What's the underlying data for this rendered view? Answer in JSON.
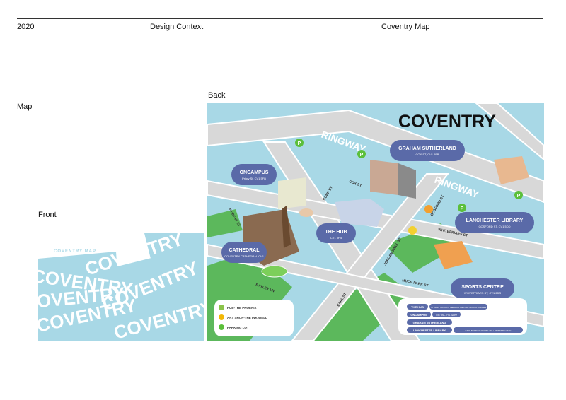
{
  "header": {
    "year": "2020",
    "section": "Design Context",
    "project": "Coventry Map"
  },
  "labels": {
    "map": "Map",
    "front": "Front",
    "back": "Back"
  },
  "front": {
    "small_title": "COVENTRY MAP",
    "word": "COVENTRY"
  },
  "back_map": {
    "title": "COVENTRY",
    "roads": {
      "ringway": "RINGWAY",
      "ringway2": "RINGWAY",
      "corp": "CORP ST",
      "cox": "COX ST",
      "fairfax": "FAIRFAX ST",
      "gosford": "GOSFORD ST",
      "whitefriars": "WHITEFRIARS ST",
      "jordan": "JORDAN WELL ST",
      "much_park": "MUCH PARK ST",
      "bayley": "BAYLEY LN",
      "earl": "EARL ST"
    },
    "places": [
      {
        "name": "GRAHAM SUTHERLAND",
        "sub": "COX ST, CV1 5FB"
      },
      {
        "name": "ONCAMPUS",
        "sub": "Priory St, CV1 5FB"
      },
      {
        "name": "THE HUB",
        "sub": "CV1 5FB"
      },
      {
        "name": "LANCHESTER LIBRARY",
        "sub": "GOSFORD ST, CV1 5DD"
      },
      {
        "name": "CATHEDRAL",
        "sub": "COVENTRY CATHEDRAL CV1"
      },
      {
        "name": "SPORTS CENTRE",
        "sub": "WHITEFRIARS ST, CV1 2DS"
      }
    ],
    "legend": [
      {
        "label": "PUB-THE PHOENIX",
        "color": "#8bc34a"
      },
      {
        "label": "ART SHOP-THE INK WELL",
        "color": "#f2b705"
      },
      {
        "label": "PARKING LOT",
        "color": "#5bbf3a"
      }
    ],
    "key": [
      {
        "name": "THE HUB",
        "detail": "STUDENT UNION / MEDICAL CENTRE / PASTA COFFEE"
      },
      {
        "name": "ONCAMPUS",
        "detail": "IFP / DNL / IY1 / ELPP"
      },
      {
        "name": "GRAHAM SUTHERLAND",
        "detail": ""
      },
      {
        "name": "LANCHESTER LIBRARY",
        "detail": "GROUP STUDY ROOM / PC / PRINTER / CAFE"
      }
    ]
  },
  "colors": {
    "water": "#a8d8e6",
    "road": "#d8d8d8",
    "grass": "#5cb85c",
    "pill": "#5a6aa8",
    "front_bg": "#a8d8e6"
  }
}
